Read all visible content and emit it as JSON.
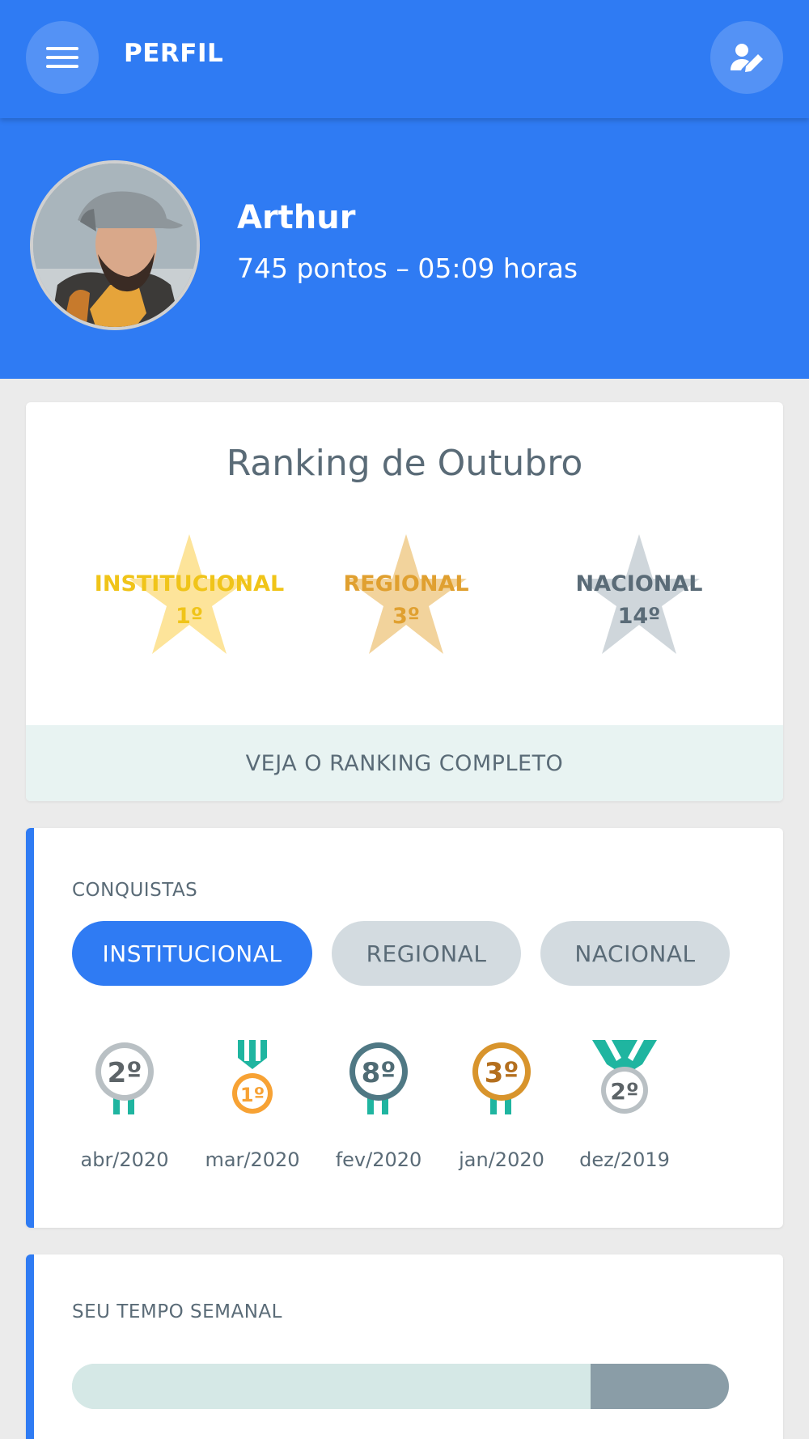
{
  "header": {
    "title": "PERFIL",
    "menu_icon": "hamburger-menu-icon",
    "edit_icon": "edit-profile-icon",
    "accent_color": "#2f7bf3"
  },
  "profile": {
    "name": "Arthur",
    "stats": "745 pontos – 05:09 horas"
  },
  "ranking": {
    "title": "Ranking de Outubro",
    "items": [
      {
        "label": "INSTITUCIONAL",
        "position": "1º",
        "color": "#f0c419",
        "star_color": "#fde49a"
      },
      {
        "label": "REGIONAL",
        "position": "3º",
        "color": "#e0a030",
        "star_color": "#f2d39c"
      },
      {
        "label": "NACIONAL",
        "position": "14º",
        "color": "#5a6b77",
        "star_color": "#cfd6db"
      }
    ],
    "link": "VEJA O RANKING COMPLETO"
  },
  "conquistas": {
    "title": "CONQUISTAS",
    "tabs": [
      "INSTITUCIONAL",
      "REGIONAL",
      "NACIONAL"
    ],
    "active_tab": "INSTITUCIONAL",
    "medals": [
      {
        "place": "2º",
        "date": "abr/2020",
        "type": "silver"
      },
      {
        "place": "1º",
        "date": "mar/2020",
        "type": "gold"
      },
      {
        "place": "8º",
        "date": "fev/2020",
        "type": "steel"
      },
      {
        "place": "3º",
        "date": "jan/2020",
        "type": "bronze"
      },
      {
        "place": "2º",
        "date": "dez/2019",
        "type": "silver-ribbon"
      }
    ]
  },
  "tempo": {
    "title": "SEU TEMPO SEMANAL",
    "progress_fraction": 0.79
  }
}
